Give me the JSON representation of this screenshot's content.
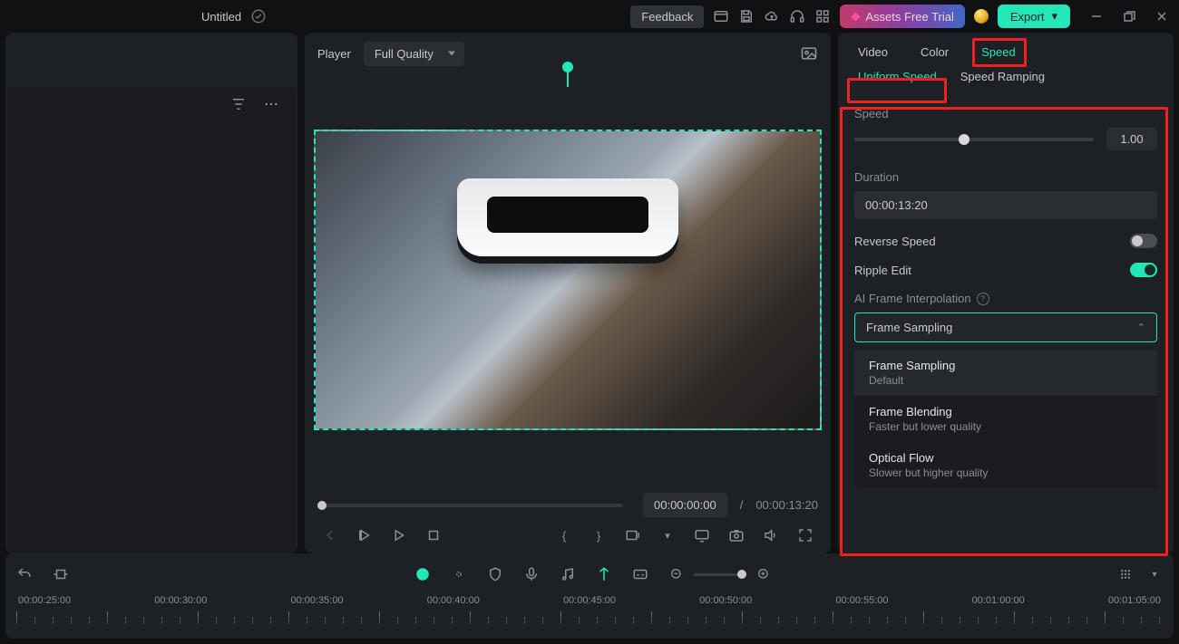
{
  "titlebar": {
    "doc_title": "Untitled",
    "feedback": "Feedback",
    "assets_trial": "Assets Free Trial",
    "export": "Export"
  },
  "player": {
    "label": "Player",
    "quality": "Full Quality",
    "current_time": "00:00:00:00",
    "separator": "/",
    "total_time": "00:00:13:20"
  },
  "inspector": {
    "tabs": {
      "video": "Video",
      "color": "Color",
      "speed": "Speed"
    },
    "subtabs": {
      "uniform": "Uniform Speed",
      "ramping": "Speed Ramping"
    },
    "speed_label": "Speed",
    "speed_value": "1.00",
    "duration_label": "Duration",
    "duration_value": "00:00:13:20",
    "reverse_label": "Reverse Speed",
    "ripple_label": "Ripple Edit",
    "ai_interp_label": "AI Frame Interpolation",
    "interp_selected": "Frame Sampling",
    "interp_options": [
      {
        "title": "Frame Sampling",
        "sub": "Default"
      },
      {
        "title": "Frame Blending",
        "sub": "Faster but lower quality"
      },
      {
        "title": "Optical Flow",
        "sub": "Slower but higher quality"
      }
    ]
  },
  "timeline": {
    "marks": [
      "00:00:25:00",
      "00:00:30:00",
      "00:00:35:00",
      "00:00:40:00",
      "00:00:45:00",
      "00:00:50:00",
      "00:00:55:00",
      "00:01:00:00",
      "00:01:05:00"
    ]
  }
}
